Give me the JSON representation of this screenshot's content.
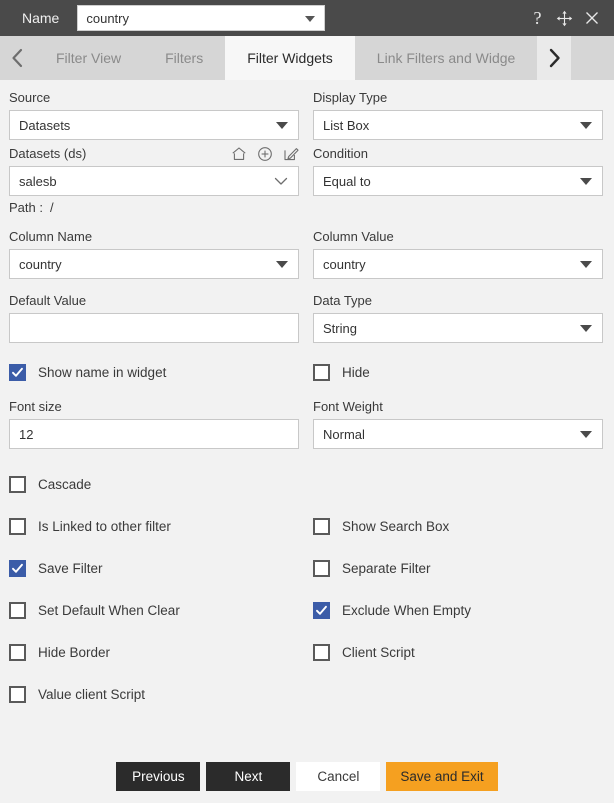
{
  "titlebar": {
    "name_label": "Name",
    "name_value": "country",
    "help_icon": "question-mark-icon",
    "move_icon": "move-arrows-icon",
    "close_icon": "close-icon"
  },
  "tabs": {
    "prev_icon": "chevron-left-icon",
    "next_icon": "chevron-right-icon",
    "items": [
      {
        "label": "Filter View",
        "active": false
      },
      {
        "label": "Filters",
        "active": false
      },
      {
        "label": "Filter Widgets",
        "active": true
      },
      {
        "label": "Link Filters and Widge",
        "active": false
      }
    ]
  },
  "form": {
    "source": {
      "label": "Source",
      "value": "Datasets"
    },
    "display_type": {
      "label": "Display Type",
      "value": "List Box"
    },
    "datasets": {
      "label": "Datasets (ds)",
      "value": "salesb",
      "home_icon": "home-icon",
      "add_icon": "plus-circle-icon",
      "edit_icon": "edit-pencil-icon"
    },
    "condition": {
      "label": "Condition",
      "value": "Equal to"
    },
    "path": {
      "label": "Path :",
      "value": "/"
    },
    "column_name": {
      "label": "Column Name",
      "value": "country"
    },
    "column_value": {
      "label": "Column Value",
      "value": "country"
    },
    "default_value": {
      "label": "Default Value",
      "value": ""
    },
    "data_type": {
      "label": "Data Type",
      "value": "String"
    },
    "font_size": {
      "label": "Font size",
      "value": "12"
    },
    "font_weight": {
      "label": "Font Weight",
      "value": "Normal"
    }
  },
  "checkboxes": [
    {
      "label": "Show name in widget",
      "checked": true
    },
    {
      "label": "Hide",
      "checked": false
    },
    {
      "label": "Cascade",
      "checked": false
    },
    {
      "label": "Is Linked to other filter",
      "checked": false
    },
    {
      "label": "Show Search Box",
      "checked": false
    },
    {
      "label": "Save Filter",
      "checked": true
    },
    {
      "label": "Separate Filter",
      "checked": false
    },
    {
      "label": "Set Default When Clear",
      "checked": false
    },
    {
      "label": "Exclude When Empty",
      "checked": true
    },
    {
      "label": "Hide Border",
      "checked": false
    },
    {
      "label": "Client Script",
      "checked": false
    },
    {
      "label": "Value client Script",
      "checked": false
    }
  ],
  "footer": {
    "previous": "Previous",
    "next": "Next",
    "cancel": "Cancel",
    "save_and_exit": "Save and Exit"
  },
  "colors": {
    "titlebar_bg": "#4a4a4a",
    "tab_bg": "#d6d6d6",
    "active_tab_bg": "#f7f7f7",
    "body_bg": "#f2f2f2",
    "checkbox_checked": "#3b5ca8",
    "accent_button": "#f5a020",
    "dark_button": "#2b2b2b"
  }
}
